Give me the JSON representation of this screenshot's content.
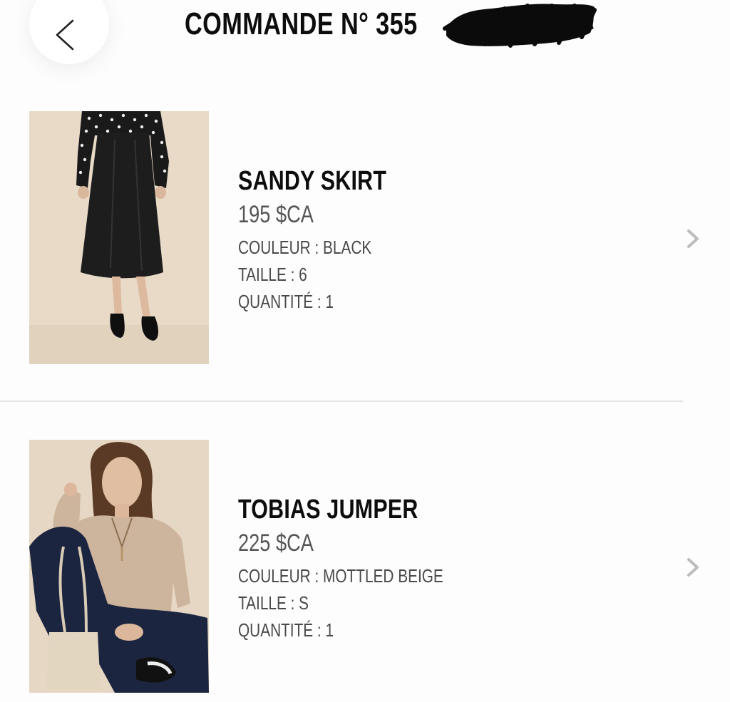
{
  "header": {
    "title": "COMMANDE N° 355",
    "back_icon": "chevron-left-icon"
  },
  "items": [
    {
      "name": "SANDY SKIRT",
      "price": "195 $CA",
      "color": "COULEUR : BLACK",
      "size": "TAILLE : 6",
      "quantity": "QUANTITÉ : 1",
      "image_icon": "product-photo-skirt",
      "chevron_icon": "chevron-right-icon"
    },
    {
      "name": "TOBIAS JUMPER",
      "price": "225 $CA",
      "color": "COULEUR : MOTTLED BEIGE",
      "size": "TAILLE : S",
      "quantity": "QUANTITÉ : 1",
      "image_icon": "product-photo-jumper",
      "chevron_icon": "chevron-right-icon"
    }
  ],
  "colors": {
    "background": "#fdfdfd",
    "text_primary": "#0d0d0d",
    "text_secondary": "#4a4a4a",
    "divider": "#e4e4e4",
    "chevron": "#bdbdbd",
    "photo_backdrop": "#e9dccb"
  }
}
